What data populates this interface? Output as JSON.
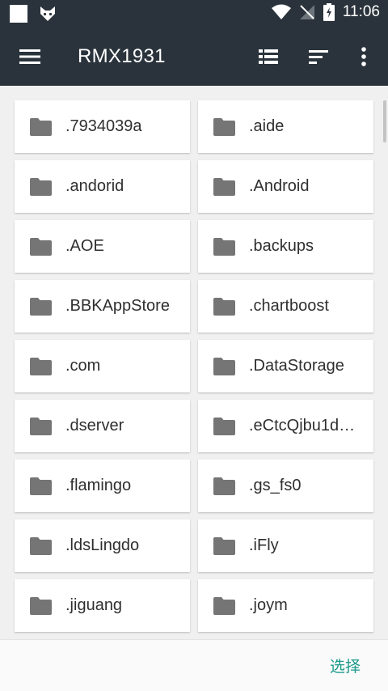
{
  "status_bar": {
    "time": "11:06",
    "icons": [
      "square-notification-icon",
      "fox-app-icon",
      "wifi-icon",
      "no-sim-icon",
      "battery-charging-icon"
    ]
  },
  "app_bar": {
    "title": "RMX1931",
    "icons": [
      "menu-icon",
      "list-view-icon",
      "sort-icon",
      "more-vert-icon"
    ]
  },
  "files": [
    {
      "name": ".7934039a"
    },
    {
      "name": ".aide"
    },
    {
      "name": ".andorid"
    },
    {
      "name": ".Android"
    },
    {
      "name": ".AOE"
    },
    {
      "name": ".backups"
    },
    {
      "name": ".BBKAppStore"
    },
    {
      "name": ".chartboost"
    },
    {
      "name": ".com"
    },
    {
      "name": ".DataStorage"
    },
    {
      "name": ".dserver"
    },
    {
      "name": ".eCtcQjbu1d…"
    },
    {
      "name": ".flamingo"
    },
    {
      "name": ".gs_fs0"
    },
    {
      "name": ".ldsLingdo"
    },
    {
      "name": ".iFly"
    },
    {
      "name": ".jiguang"
    },
    {
      "name": ".joym"
    }
  ],
  "bottom_bar": {
    "select_label": "选择"
  },
  "colors": {
    "app_bar": "#2a333b",
    "folder_icon": "#757575",
    "accent": "#1c9a8a"
  }
}
